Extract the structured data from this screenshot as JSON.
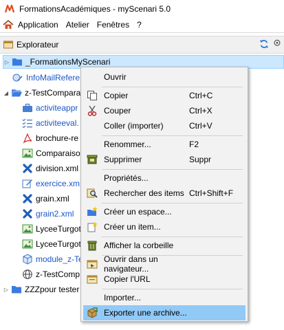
{
  "window": {
    "title": "FormationsAcadémiques - myScenari 5.0"
  },
  "menubar": {
    "items": [
      "Application",
      "Atelier",
      "Fenêtres",
      "?"
    ]
  },
  "panel": {
    "title": "Explorateur"
  },
  "tree": {
    "root": "_FormationsMyScenari",
    "items": [
      {
        "label": "InfoMailRefere",
        "icon": "globe-link-icon"
      },
      {
        "label": "z-TestCompara",
        "icon": "open-folder-icon"
      },
      {
        "label": "activiteappr",
        "icon": "briefcase-icon"
      },
      {
        "label": "activiteeval.",
        "icon": "checklist-icon"
      },
      {
        "label": "brochure-re",
        "icon": "pdf-icon"
      },
      {
        "label": "Comparaiso",
        "icon": "image-icon"
      },
      {
        "label": "division.xml",
        "icon": "puzzle-icon"
      },
      {
        "label": "exercice.xm",
        "icon": "pencil-icon"
      },
      {
        "label": "grain.xml",
        "icon": "puzzle-icon"
      },
      {
        "label": "grain2.xml",
        "icon": "puzzle-icon"
      },
      {
        "label": "LyceeTurgot",
        "icon": "image-icon"
      },
      {
        "label": "LyceeTurgot",
        "icon": "image-icon"
      },
      {
        "label": "module_z-Te",
        "icon": "cube-icon"
      },
      {
        "label": "z-TestComp",
        "icon": "globe-icon"
      }
    ],
    "last": "ZZZpour tester"
  },
  "context_menu": {
    "items": [
      {
        "label": "Ouvrir",
        "shortcut": "",
        "icon": ""
      },
      {
        "label": "Copier",
        "shortcut": "Ctrl+C",
        "icon": "copy-icon"
      },
      {
        "label": "Couper",
        "shortcut": "Ctrl+X",
        "icon": "scissors-icon"
      },
      {
        "label": "Coller (importer)",
        "shortcut": "Ctrl+V",
        "icon": ""
      },
      {
        "label": "Renommer...",
        "shortcut": "F2",
        "icon": ""
      },
      {
        "label": "Supprimer",
        "shortcut": "Suppr",
        "icon": "delete-icon"
      },
      {
        "label": "Propriétés...",
        "shortcut": "",
        "icon": ""
      },
      {
        "label": "Rechercher des items",
        "shortcut": "Ctrl+Shift+F",
        "icon": "search-icon"
      },
      {
        "label": "Créer un espace...",
        "shortcut": "",
        "icon": "new-space-icon"
      },
      {
        "label": "Créer un item...",
        "shortcut": "",
        "icon": "new-item-icon"
      },
      {
        "label": "Afficher la corbeille",
        "shortcut": "",
        "icon": "trash-icon"
      },
      {
        "label": "Ouvrir dans un navigateur...",
        "shortcut": "",
        "icon": "browser-icon"
      },
      {
        "label": "Copier l'URL",
        "shortcut": "",
        "icon": "url-icon"
      },
      {
        "label": "Importer...",
        "shortcut": "",
        "icon": ""
      },
      {
        "label": "Exporter une archive...",
        "shortcut": "",
        "icon": "export-archive-icon"
      }
    ]
  }
}
